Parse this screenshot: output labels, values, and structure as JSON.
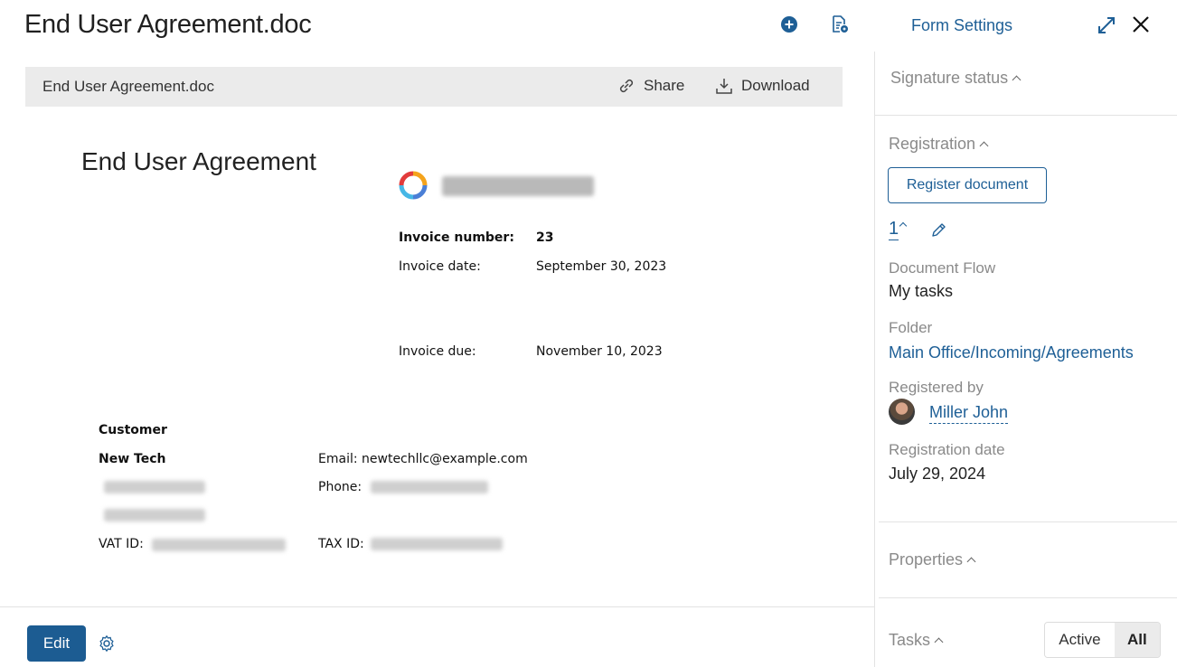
{
  "header": {
    "title": "End User Agreement.doc",
    "form_settings": "Form Settings"
  },
  "document_bar": {
    "file_name": "End User Agreement.doc",
    "share_label": "Share",
    "download_label": "Download"
  },
  "document": {
    "heading": "End User Agreement",
    "invoice_number_label": "Invoice number:",
    "invoice_number": "23",
    "invoice_date_label": "Invoice date:",
    "invoice_date": "September 30, 2023",
    "invoice_due_label": "Invoice due:",
    "invoice_due": "November 10, 2023",
    "customer_label": "Customer",
    "customer_name": "New Tech",
    "email_label": "Email:",
    "email": "newtechllc@example.com",
    "phone_label": "Phone:",
    "vat_label": "VAT ID:",
    "tax_label": "TAX ID:"
  },
  "footer": {
    "edit_label": "Edit"
  },
  "side_panel": {
    "signature_status": "Signature status",
    "registration": "Registration",
    "register_document": "Register document",
    "registration_number": "1",
    "document_flow_label": "Document Flow",
    "document_flow": "My tasks",
    "folder_label": "Folder",
    "folder": "Main Office/Incoming/Agreements",
    "registered_by_label": "Registered by",
    "registered_by": "Miller John",
    "registration_date_label": "Registration date",
    "registration_date": "July 29, 2024",
    "properties": "Properties",
    "tasks": "Tasks",
    "tasks_filter": {
      "active": "Active",
      "all": "All",
      "selected": "All"
    }
  },
  "colors": {
    "accent": "#1e5f96",
    "edit_button": "#1c5c92"
  }
}
